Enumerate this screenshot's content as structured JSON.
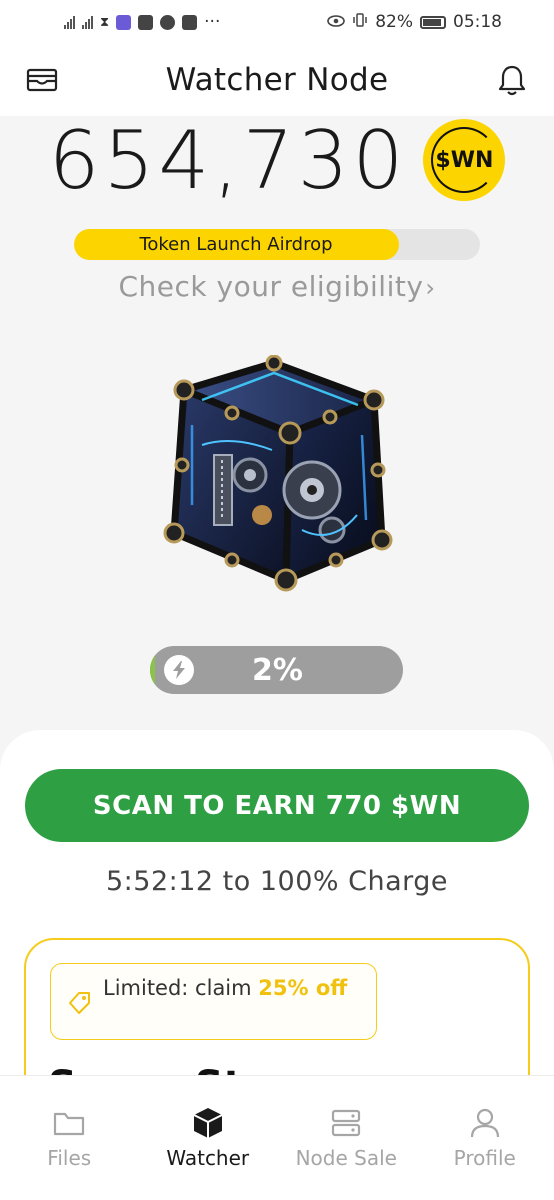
{
  "status_bar": {
    "battery": "82%",
    "time": "05:18"
  },
  "header": {
    "title": "Watcher Node",
    "left_icon": "wallet-icon",
    "right_icon": "bell-icon"
  },
  "balance": {
    "amount": "654,730",
    "token_badge": "$WN"
  },
  "airdrop": {
    "label": "Token Launch Airdrop",
    "progress": 0.8
  },
  "eligibility": {
    "text": "Check your eligibility",
    "chevron": "›"
  },
  "node": {
    "image": "watcher-node-cube"
  },
  "charge": {
    "percent_text": "2%",
    "percent": 2
  },
  "scan": {
    "label": "SCAN TO EARN 770 $WN"
  },
  "charge_time": {
    "text": "5:52:12 to 100% Charge"
  },
  "promo": {
    "prefix": "Limited: claim ",
    "highlight": "25%",
    "suffix": " off",
    "peek": "Super St"
  },
  "colors": {
    "accent_yellow": "#fcd400",
    "scan_green": "#2ea043",
    "charge_gray": "#9e9e9e"
  },
  "nav": {
    "items": [
      {
        "label": "Files",
        "icon": "folder-icon",
        "active": false
      },
      {
        "label": "Watcher",
        "icon": "cube-icon",
        "active": true
      },
      {
        "label": "Node Sale",
        "icon": "server-icon",
        "active": false
      },
      {
        "label": "Profile",
        "icon": "user-icon",
        "active": false
      }
    ]
  }
}
